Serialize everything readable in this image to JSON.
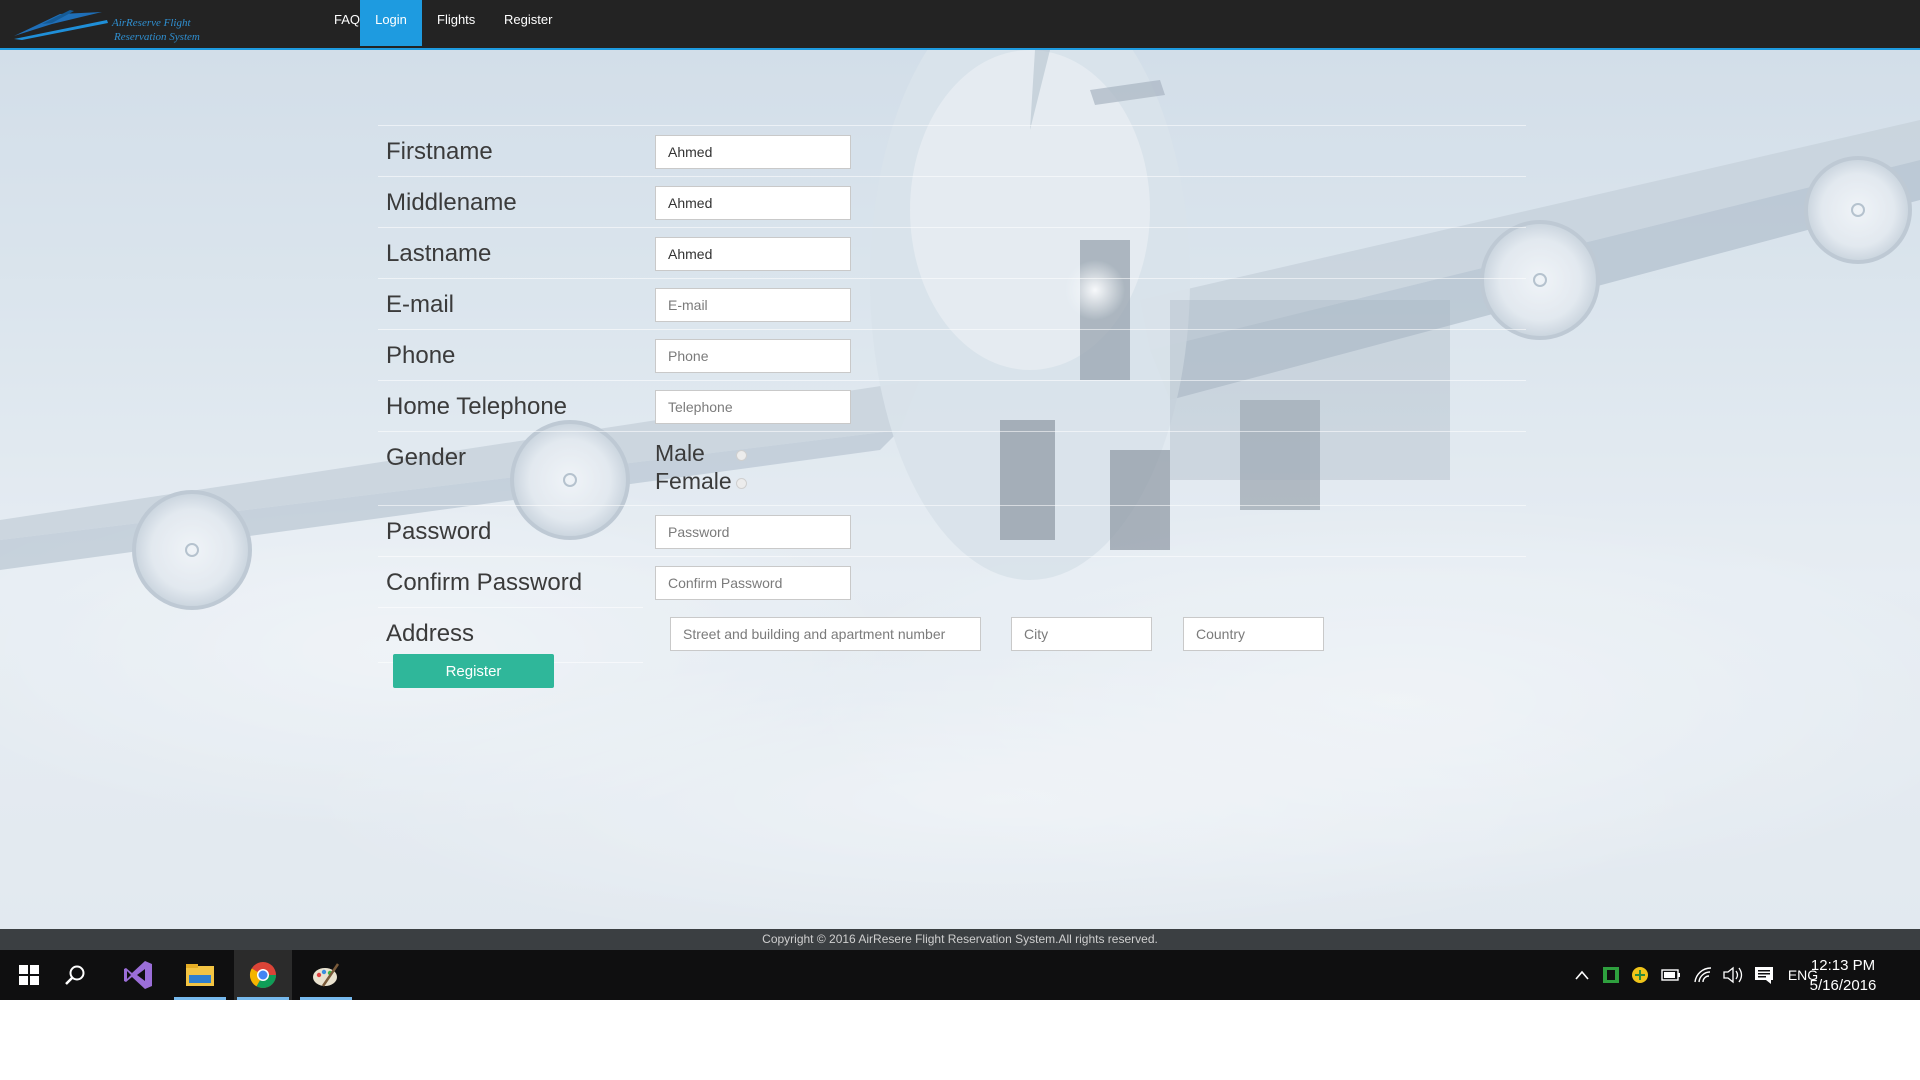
{
  "app": {
    "logo_text_line1": "AirReserve Flight",
    "logo_text_line2": "Reservation System"
  },
  "nav": {
    "items": [
      {
        "label": "FAQ"
      },
      {
        "label": "Login"
      },
      {
        "label": "Flights"
      },
      {
        "label": "Register"
      }
    ],
    "active": "Login"
  },
  "form": {
    "firstname": {
      "label": "Firstname",
      "value": "Ahmed"
    },
    "middlename": {
      "label": "Middlename",
      "value": "Ahmed"
    },
    "lastname": {
      "label": "Lastname",
      "value": "Ahmed"
    },
    "email": {
      "label": "E-mail",
      "placeholder": "E-mail"
    },
    "phone": {
      "label": "Phone",
      "placeholder": "Phone"
    },
    "home_telephone": {
      "label": "Home Telephone",
      "placeholder": "Telephone"
    },
    "gender": {
      "label": "Gender",
      "options": [
        "Male",
        "Female"
      ]
    },
    "password": {
      "label": "Password",
      "placeholder": "Password"
    },
    "confirm_password": {
      "label": "Confirm Password",
      "placeholder": "Confirm Password"
    },
    "address": {
      "label": "Address",
      "street_placeholder": "Street and building and apartment number",
      "city_placeholder": "City",
      "country_placeholder": "Country"
    },
    "register_label": "Register"
  },
  "footer": {
    "text": "Copyright © 2016 AirResere Flight Reservation System.All rights reserved."
  },
  "taskbar": {
    "apps": [
      "start-icon",
      "search-icon",
      "visual-studio-icon",
      "file-explorer-icon",
      "chrome-icon",
      "paint-icon"
    ],
    "language": "ENG",
    "time": "12:13 PM",
    "date": "5/16/2016"
  },
  "colors": {
    "nav_bg": "#232323",
    "nav_active": "#1e9be0",
    "register_button": "#2fb79a",
    "footer_bg": "#3b3f42",
    "taskbar_bg": "#0f0f10"
  }
}
